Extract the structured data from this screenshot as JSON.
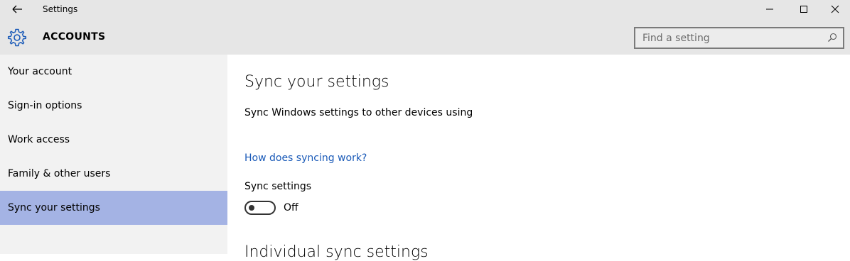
{
  "window": {
    "title": "Settings"
  },
  "header": {
    "section_title": "ACCOUNTS",
    "search_placeholder": "Find a setting"
  },
  "sidebar": {
    "items": [
      {
        "label": "Your account",
        "selected": false
      },
      {
        "label": "Sign-in options",
        "selected": false
      },
      {
        "label": "Work access",
        "selected": false
      },
      {
        "label": "Family & other users",
        "selected": false
      },
      {
        "label": "Sync your settings",
        "selected": true
      }
    ]
  },
  "main": {
    "heading": "Sync your settings",
    "description": "Sync Windows settings to other devices using",
    "link": "How does syncing work?",
    "sync_label": "Sync settings",
    "toggle_state": "Off",
    "subheading": "Individual sync settings"
  },
  "colors": {
    "accent": "#1a5ab8",
    "selected_background": "#a4b3e4",
    "chrome_background": "#e6e6e6",
    "sidebar_background": "#f2f2f2"
  }
}
